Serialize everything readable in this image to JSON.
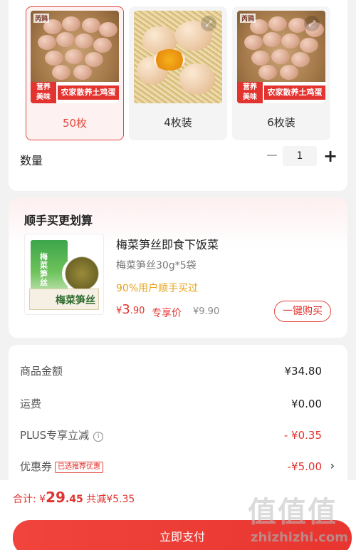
{
  "spec": {
    "options": [
      {
        "label": "50枚",
        "selected": true,
        "img_label": "营养\n美味",
        "img_name": "农家散养土鸡蛋",
        "brand": "芮鸦"
      },
      {
        "label": "4枚装",
        "selected": false
      },
      {
        "label": "6枚装",
        "selected": false,
        "img_label": "营养\n美味",
        "img_name": "农家散养土鸡蛋",
        "brand": "芮鸦"
      }
    ],
    "quantity_label": "数量",
    "minus": "−",
    "quantity": "1",
    "plus": "+",
    "zoom_icon": "expand-icon"
  },
  "promo": {
    "title": "顺手买更划算",
    "product": {
      "name": "梅菜笋丝即食下饭菜",
      "spec": "梅菜笋丝30g*5袋",
      "social_proof": "90%用户顺手买过",
      "price_symbol": "¥",
      "price_int": "3",
      "price_dec": ".90",
      "price_badge": "专享价",
      "original_price": "¥9.90",
      "buy_button": "一键购买",
      "pkg_text": "梅菜笋丝",
      "box_text": "梅菜笋丝"
    }
  },
  "summary": {
    "rows": [
      {
        "label": "商品金额",
        "value": "¥34.80"
      },
      {
        "label": "运费",
        "value": "¥0.00"
      },
      {
        "label": "PLUS专享立减",
        "value": "- ¥0.35",
        "info_icon": "info-icon"
      },
      {
        "label": "优惠券",
        "value": "-¥5.00",
        "tag": "已选推荐优惠",
        "chevron": "›"
      }
    ]
  },
  "footer": {
    "total_label": "合计: ",
    "total_symbol": "¥",
    "total_int": "29",
    "total_dec": ".45",
    "saving": "共减¥5.35",
    "pay_button": "立即支付"
  },
  "watermark": {
    "text": "值值值",
    "url": "zhizhizhi.com"
  }
}
